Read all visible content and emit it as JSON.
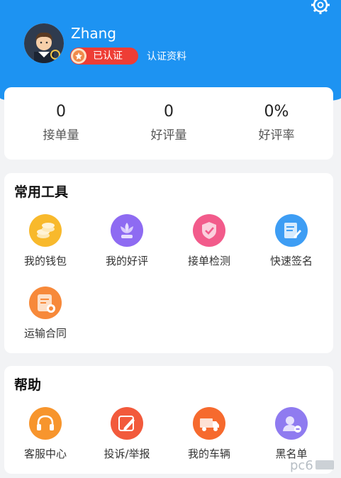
{
  "profile": {
    "name": "Zhang",
    "cert_status": "已认证",
    "cert_link": "认证资料"
  },
  "stats": [
    {
      "value": "0",
      "label": "接单量"
    },
    {
      "value": "0",
      "label": "好评量"
    },
    {
      "value": "0%",
      "label": "好评率"
    }
  ],
  "tools": {
    "title": "常用工具",
    "items": [
      {
        "label": "我的钱包",
        "icon": "wallet-coins-icon",
        "color": "#f8b92c"
      },
      {
        "label": "我的好评",
        "icon": "flower-icon",
        "color": "#8e6bf2"
      },
      {
        "label": "接单检测",
        "icon": "shield-check-icon",
        "color": "#f25b8b"
      },
      {
        "label": "快速签名",
        "icon": "signature-doc-icon",
        "color": "#3d9df4"
      },
      {
        "label": "运输合同",
        "icon": "contract-icon",
        "color": "#f7893a"
      }
    ]
  },
  "help": {
    "title": "帮助",
    "items": [
      {
        "label": "客服中心",
        "icon": "headset-icon",
        "color": "#f7952d"
      },
      {
        "label": "投诉/举报",
        "icon": "edit-icon",
        "color": "#f25a3c"
      },
      {
        "label": "我的车辆",
        "icon": "truck-icon",
        "color": "#f66a2e"
      },
      {
        "label": "黑名单",
        "icon": "blacklist-user-icon",
        "color": "#8f7bf0"
      }
    ]
  },
  "watermark": "pc6"
}
